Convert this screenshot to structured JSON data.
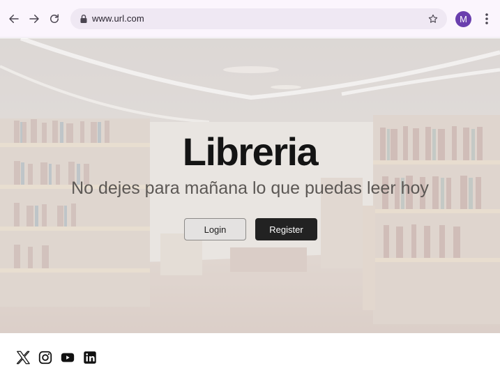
{
  "browser": {
    "url": "www.url.com",
    "avatar_letter": "M",
    "icons": [
      "back-arrow-icon",
      "forward-arrow-icon",
      "reload-icon",
      "lock-icon",
      "star-icon",
      "kebab-menu-icon"
    ],
    "avatar_color": "#6a3fae"
  },
  "hero": {
    "title": "Libreria",
    "subtitle": "No dejes para mañana lo que puedas leer hoy",
    "login_label": "Login",
    "register_label": "Register"
  },
  "footer": {
    "social_icons": [
      "x-icon",
      "instagram-icon",
      "youtube-icon",
      "linkedin-icon"
    ]
  },
  "colors": {
    "register_bg": "#222222",
    "login_bg": "#e4e2e1",
    "chrome_bg": "#fbf5fd"
  }
}
